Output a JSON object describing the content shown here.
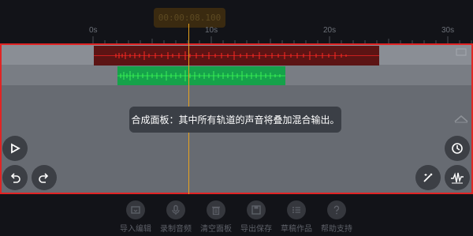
{
  "timer": {
    "value": "00:00:08.100"
  },
  "ruler": {
    "labels": [
      "0s",
      "10s",
      "20s",
      "30s"
    ]
  },
  "tooltip": {
    "text": "合成面板：其中所有轨道的声音将叠加混合输出。"
  },
  "colors": {
    "accent": "#e8a21e",
    "panel_border": "#e02424",
    "clip_red": "#e0231f",
    "clip_green": "#2ee64a"
  },
  "controls": {
    "play": "play-icon",
    "undo": "undo-icon",
    "redo": "redo-icon",
    "timer": "timer-icon",
    "magic": "magic-wand-icon",
    "waveform": "waveform-icon",
    "up": "chevron-up-icon"
  },
  "toolbar": [
    {
      "label": "导入编辑",
      "icon": "import-icon"
    },
    {
      "label": "录制音频",
      "icon": "mic-icon"
    },
    {
      "label": "清空面板",
      "icon": "trash-icon"
    },
    {
      "label": "导出保存",
      "icon": "save-icon"
    },
    {
      "label": "草稿作品",
      "icon": "list-icon"
    },
    {
      "label": "帮助支持",
      "icon": "help-icon"
    }
  ]
}
